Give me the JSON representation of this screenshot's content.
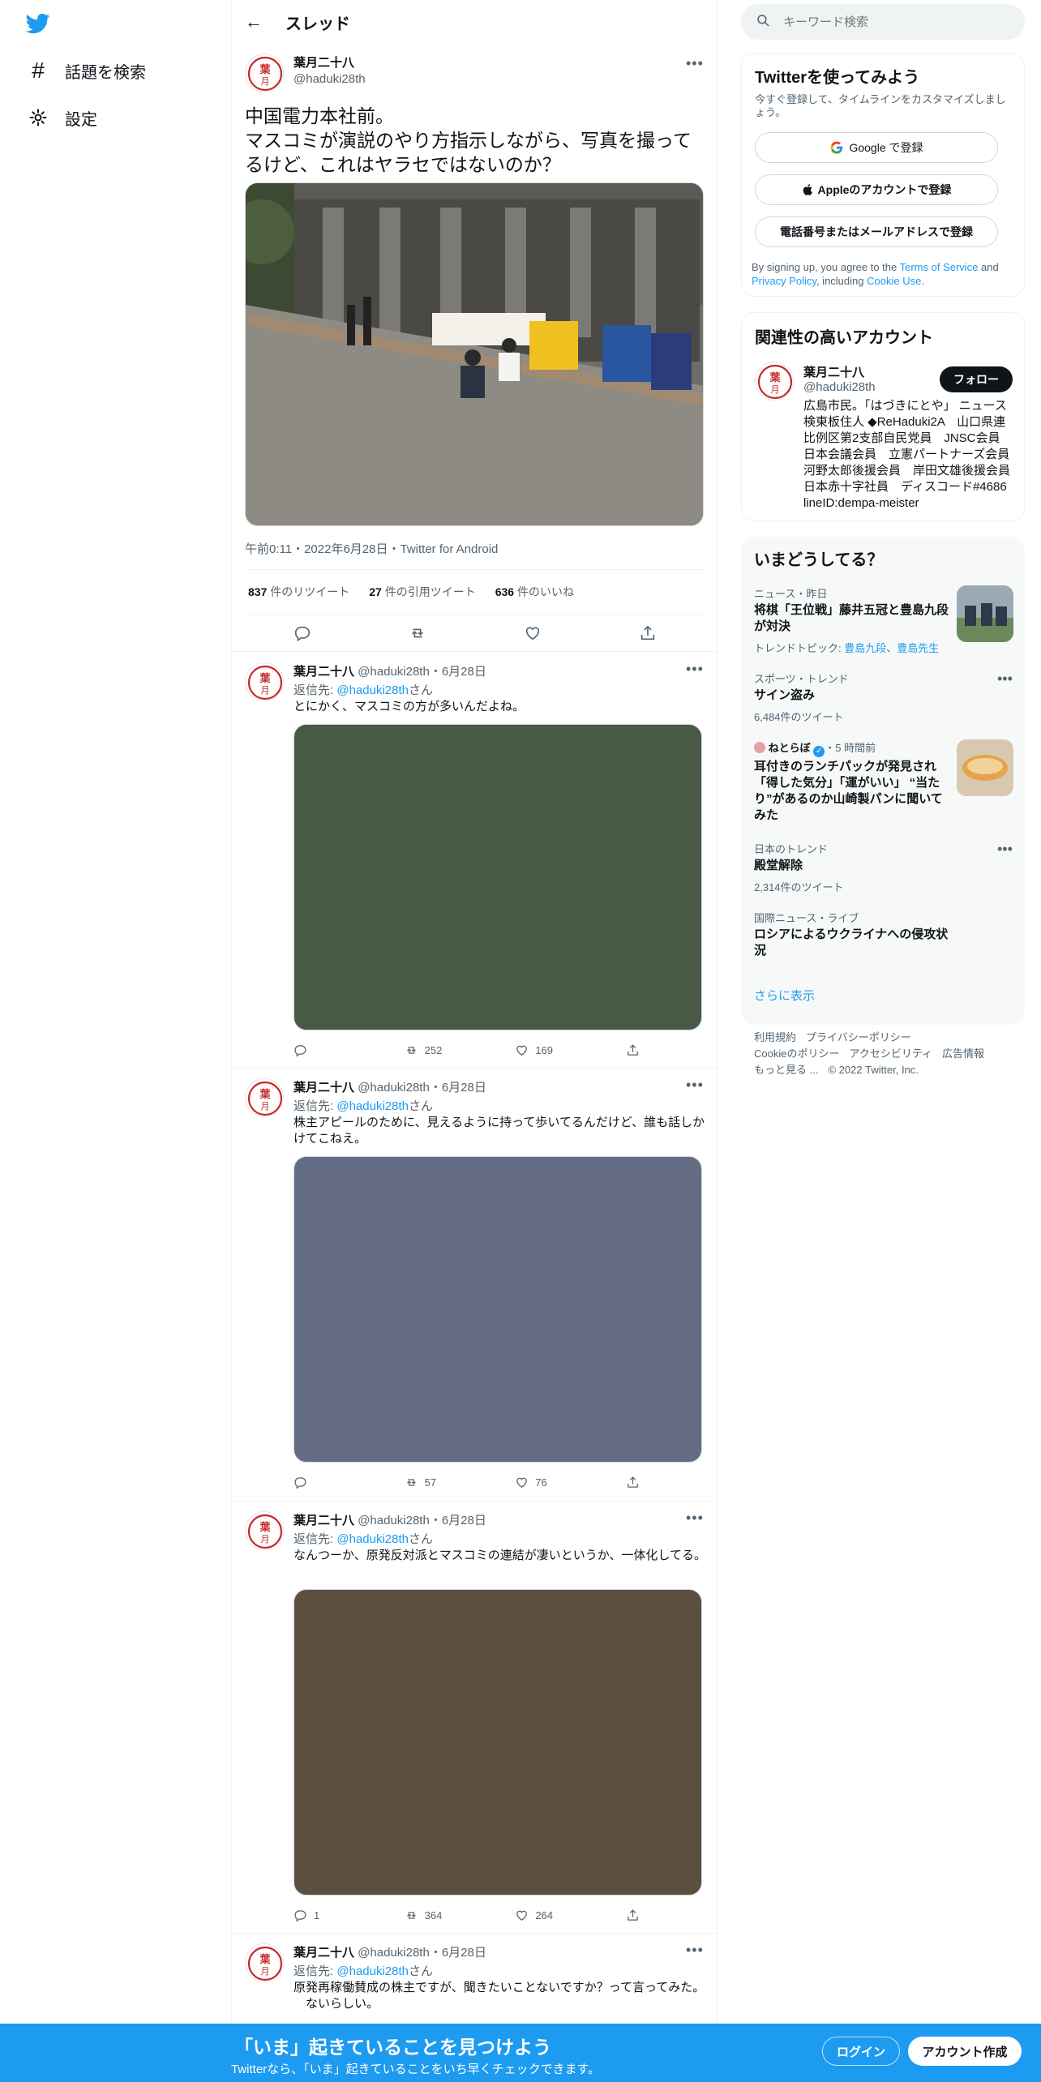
{
  "nav": {
    "explore_label": "話題を検索",
    "settings_label": "設定"
  },
  "header": {
    "title": "スレッド"
  },
  "main_tweet": {
    "name": "葉月二十八",
    "handle": "@haduki28th",
    "text": "中国電力本社前。\nマスコミが演説のやり方指示しながら、写真を撮ってるけど、これはヤラセではないのか？",
    "meta": "午前0:11・2022年6月28日・Twitter for Android",
    "retweets_num": "837",
    "retweets_label": "件のリツイート",
    "quotes_num": "27",
    "quotes_label": "件の引用ツイート",
    "likes_num": "636",
    "likes_label": "件のいいね"
  },
  "replies": [
    {
      "name": "葉月二十八",
      "handle": "@haduki28th",
      "date": "・6月28日",
      "reply_prefix": "返信先: ",
      "reply_to": "@haduki28th",
      "reply_suffix": "さん",
      "text": "とにかく、マスコミの方が多いんだよね。",
      "image_color": "#485a45",
      "replies": "",
      "retweets": "252",
      "likes": "169"
    },
    {
      "name": "葉月二十八",
      "handle": "@haduki28th",
      "date": "・6月28日",
      "reply_prefix": "返信先: ",
      "reply_to": "@haduki28th",
      "reply_suffix": "さん",
      "text": "株主アピールのために、見えるように持って歩いてるんだけど、誰も話しかけてこねえ。",
      "image_color": "#636c83",
      "replies": "",
      "retweets": "57",
      "likes": "76"
    },
    {
      "name": "葉月二十八",
      "handle": "@haduki28th",
      "date": "・6月28日",
      "reply_prefix": "返信先: ",
      "reply_to": "@haduki28th",
      "reply_suffix": "さん",
      "text": "なんつーか、原発反対派とマスコミの連結が凄いというか、一体化してる。",
      "image_color": "#5b4f40",
      "replies": "1",
      "retweets": "364",
      "likes": "264"
    },
    {
      "name": "葉月二十八",
      "handle": "@haduki28th",
      "date": "・6月28日",
      "reply_prefix": "返信先: ",
      "reply_to": "@haduki28th",
      "reply_suffix": "さん",
      "text": "原発再稼働賛成の株主ですが、聞きたいことないですか？って言ってみた。\n　ないらしい。"
    }
  ],
  "search": {
    "placeholder": "キーワード検索"
  },
  "signup": {
    "title": "Twitterを使ってみよう",
    "subtitle": "今すぐ登録して、タイムラインをカスタマイズしましょう。",
    "google": "Google で登録",
    "apple": "Appleのアカウントで登録",
    "phone": "電話番号またはメールアドレスで登録",
    "legal_1": "By signing up, you agree to the ",
    "legal_tos": "Terms of Service",
    "legal_2": " and ",
    "legal_privacy": "Privacy Policy",
    "legal_3": ", including ",
    "legal_cookie": "Cookie Use",
    "legal_4": "."
  },
  "related": {
    "title": "関連性の高いアカウント",
    "name": "葉月二十八",
    "handle": "@haduki28th",
    "follow": "フォロー",
    "bio": "広島市民。「はづきにとや」 ニュース検東板住人 ◆ReHaduki2A　山口県連比例区第2支部自民党員　JNSC会員　　日本会議会員　立憲パートナーズ会員　河野太郎後援会員　岸田文雄後援会員　日本赤十字社員　ディスコード#4686 lineID:dempa-meister"
  },
  "trends": {
    "title": "いまどうしてる？",
    "items": [
      {
        "context": "ニュース・昨日",
        "title": "将棋「王位戦」藤井五冠と豊島九段が対決",
        "sub_prefix": "トレンドトピック: ",
        "sub_link_1": "豊島九段",
        "sub_sep": "、",
        "sub_link_2": "豊島先生"
      },
      {
        "context": "スポーツ・トレンド",
        "title": "サイン盗み",
        "sub": "6,484件のツイート"
      },
      {
        "source": "ねとらぼ",
        "time": "・5 時間前",
        "title": "耳付きのランチパックが発見され「得した気分」「運がいい」 “当たり”があるのか山崎製パンに聞いてみた"
      },
      {
        "context": "日本のトレンド",
        "title": "殿堂解除",
        "sub": "2,314件のツイート"
      },
      {
        "context": "国際ニュース・ライブ",
        "title": "ロシアによるウクライナへの侵攻状況"
      }
    ],
    "show_more": "さらに表示"
  },
  "footer": {
    "terms": "利用規約",
    "privacy": "プライバシーポリシー",
    "cookie": "Cookieのポリシー",
    "accessibility": "アクセシビリティ",
    "ads": "広告情報",
    "more": "もっと見る ...",
    "copyright": "© 2022 Twitter, Inc."
  },
  "banner": {
    "title": "「いま」起きていることを見つけよう",
    "subtitle": "Twitterなら、「いま」起きていることをいち早くチェックできます。",
    "login": "ログイン",
    "signup": "アカウント作成"
  },
  "colors": {
    "accent": "#1d9bf0",
    "text": "#0f1419",
    "secondary": "#536471",
    "avatar_red": "#c62828"
  }
}
